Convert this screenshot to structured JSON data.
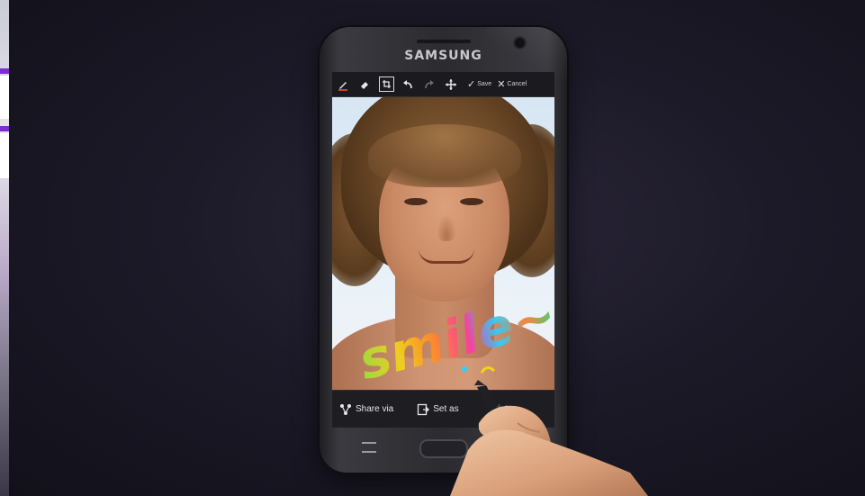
{
  "device": {
    "brand": "SAMSUNG"
  },
  "toolbar": {
    "tools": [
      {
        "icon": "pen-icon",
        "glyph": "✎"
      },
      {
        "icon": "eraser-icon",
        "glyph": "◈"
      },
      {
        "icon": "crop-icon",
        "glyph": "⌗"
      },
      {
        "icon": "undo-icon",
        "glyph": "↶"
      },
      {
        "icon": "redo-icon",
        "glyph": "↷"
      },
      {
        "icon": "move-icon",
        "glyph": "✥"
      }
    ],
    "save_label": "Save",
    "cancel_label": "Cancel"
  },
  "canvas": {
    "handwriting": "smile~",
    "colors": [
      "#9fe23a",
      "#f5d21a",
      "#ff8a2a",
      "#ff3aa0",
      "#2ad0ff",
      "#2ad46a"
    ]
  },
  "actions": {
    "share_label": "Share via",
    "set_label": "Set as",
    "print_label": "Print"
  }
}
